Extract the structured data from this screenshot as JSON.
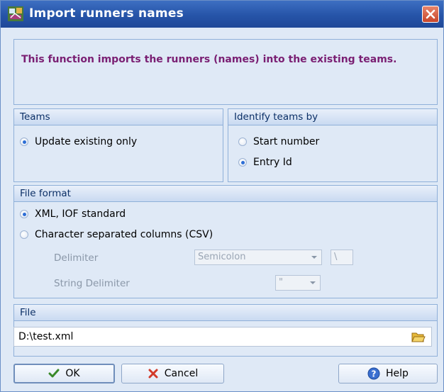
{
  "window": {
    "title": "Import runners names",
    "close_icon": "close-icon",
    "app_icon": "app-icon"
  },
  "info": {
    "text": "This function imports the runners (names) into the existing teams."
  },
  "teams": {
    "title": "Teams",
    "option": "Update existing only",
    "selected": true
  },
  "identify": {
    "title": "Identify teams by",
    "options": [
      {
        "label": "Start number",
        "selected": false
      },
      {
        "label": "Entry Id",
        "selected": true
      }
    ]
  },
  "file_format": {
    "title": "File format",
    "options": [
      {
        "label": "XML, IOF standard",
        "selected": true
      },
      {
        "label": "Character separated columns (CSV)",
        "selected": false
      }
    ],
    "delimiter_label": "Delimiter",
    "delimiter_value": "Semicolon",
    "delimiter_char": "\\",
    "string_delimiter_label": "String Delimiter",
    "string_delimiter_value": "\""
  },
  "file": {
    "title": "File",
    "value": "D:\\test.xml",
    "icon": "folder-icon"
  },
  "buttons": {
    "ok": "OK",
    "cancel": "Cancel",
    "help": "Help"
  },
  "colors": {
    "title_bar": "#2654a8",
    "info_text": "#7a1f73",
    "panel_bg": "#dfe9f6",
    "group_header_text": "#0b2f66"
  }
}
